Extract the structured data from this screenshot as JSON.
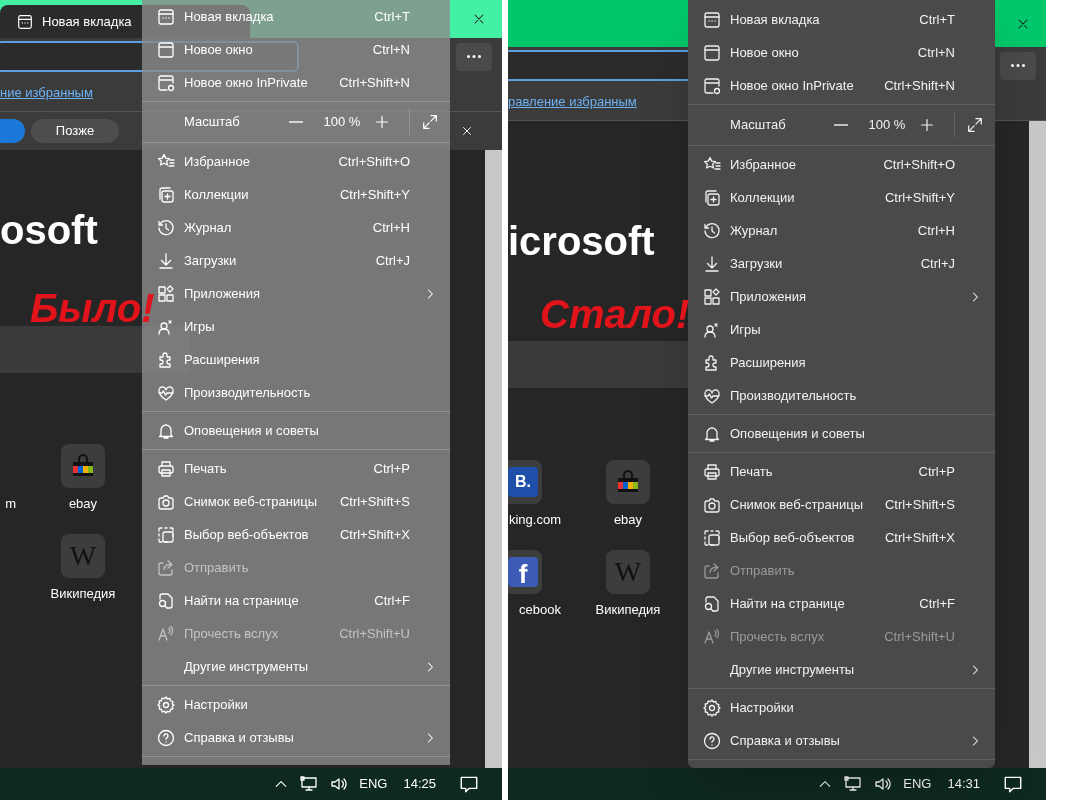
{
  "panels": [
    {
      "caption": "Было!",
      "translucent_menu": true,
      "tab": {
        "title": "Новая вкладка"
      },
      "favorites_link": "ние избранным",
      "notification": {
        "later_button": "Позже"
      },
      "brand": "osoft",
      "tile_rows": [
        [
          {
            "label": "m"
          },
          {
            "label": "ebay",
            "kind": "bag"
          }
        ],
        [
          {
            "label": "Википедия",
            "kind": "letter",
            "glyph": "W"
          }
        ]
      ],
      "menu": {
        "items": [
          {
            "kind": "item",
            "label": "Новая вкладка",
            "shortcut": "Ctrl+T",
            "disabled": false
          },
          {
            "kind": "item",
            "label": "Новое окно",
            "shortcut": "Ctrl+N",
            "disabled": false
          },
          {
            "kind": "item",
            "label": "Новое окно InPrivate",
            "shortcut": "Ctrl+Shift+N",
            "disabled": false
          },
          {
            "kind": "divider"
          },
          {
            "kind": "zoom",
            "label": "Масштаб",
            "value": "100 %"
          },
          {
            "kind": "divider"
          },
          {
            "kind": "item",
            "label": "Избранное",
            "shortcut": "Ctrl+Shift+O",
            "disabled": false
          },
          {
            "kind": "item",
            "label": "Коллекции",
            "shortcut": "Ctrl+Shift+Y",
            "disabled": false
          },
          {
            "kind": "item",
            "label": "Журнал",
            "shortcut": "Ctrl+H",
            "disabled": false
          },
          {
            "kind": "item",
            "label": "Загрузки",
            "shortcut": "Ctrl+J",
            "disabled": false
          },
          {
            "kind": "item",
            "label": "Приложения",
            "submenu": true,
            "disabled": false
          },
          {
            "kind": "item",
            "label": "Игры",
            "disabled": false
          },
          {
            "kind": "item",
            "label": "Расширения",
            "disabled": false
          },
          {
            "kind": "item",
            "label": "Производительность",
            "disabled": false
          },
          {
            "kind": "divider"
          },
          {
            "kind": "item",
            "label": "Оповещения и советы",
            "disabled": false
          },
          {
            "kind": "divider"
          },
          {
            "kind": "item",
            "label": "Печать",
            "shortcut": "Ctrl+P",
            "disabled": false
          },
          {
            "kind": "item",
            "label": "Снимок веб-страницы",
            "shortcut": "Ctrl+Shift+S",
            "disabled": false
          },
          {
            "kind": "item",
            "label": "Выбор веб-объектов",
            "shortcut": "Ctrl+Shift+X",
            "disabled": false
          },
          {
            "kind": "item",
            "label": "Отправить",
            "disabled": true
          },
          {
            "kind": "item",
            "label": "Найти на странице",
            "shortcut": "Ctrl+F",
            "disabled": false
          },
          {
            "kind": "item",
            "label": "Прочесть вслух",
            "shortcut": "Ctrl+Shift+U",
            "disabled": true
          },
          {
            "kind": "item",
            "label": "Другие инструменты",
            "submenu": true,
            "disabled": false
          },
          {
            "kind": "divider"
          },
          {
            "kind": "item",
            "label": "Настройки",
            "disabled": false
          },
          {
            "kind": "item",
            "label": "Справка и отзывы",
            "submenu": true,
            "disabled": false
          },
          {
            "kind": "divider"
          }
        ]
      },
      "taskbar": {
        "language": "ENG",
        "time": "14:25"
      }
    },
    {
      "caption": "Стало!",
      "translucent_menu": false,
      "favorites_link": "равление избранным",
      "brand": "icrosoft",
      "tile_rows": [
        [
          {
            "label": "king.com",
            "kind": "letter",
            "glyph": "B."
          },
          {
            "label": "ebay",
            "kind": "bag"
          }
        ],
        [
          {
            "label": "cebook",
            "kind": "letter",
            "glyph": "f"
          },
          {
            "label": "Википедия",
            "kind": "letter",
            "glyph": "W"
          }
        ]
      ],
      "menu": {
        "items": [
          {
            "kind": "item",
            "label": "Новая вкладка",
            "shortcut": "Ctrl+T",
            "disabled": false
          },
          {
            "kind": "item",
            "label": "Новое окно",
            "shortcut": "Ctrl+N",
            "disabled": false
          },
          {
            "kind": "item",
            "label": "Новое окно InPrivate",
            "shortcut": "Ctrl+Shift+N",
            "disabled": false
          },
          {
            "kind": "divider"
          },
          {
            "kind": "zoom",
            "label": "Масштаб",
            "value": "100 %"
          },
          {
            "kind": "divider"
          },
          {
            "kind": "item",
            "label": "Избранное",
            "shortcut": "Ctrl+Shift+O",
            "disabled": false
          },
          {
            "kind": "item",
            "label": "Коллекции",
            "shortcut": "Ctrl+Shift+Y",
            "disabled": false
          },
          {
            "kind": "item",
            "label": "Журнал",
            "shortcut": "Ctrl+H",
            "disabled": false
          },
          {
            "kind": "item",
            "label": "Загрузки",
            "shortcut": "Ctrl+J",
            "disabled": false
          },
          {
            "kind": "item",
            "label": "Приложения",
            "submenu": true,
            "disabled": false
          },
          {
            "kind": "item",
            "label": "Игры",
            "disabled": false
          },
          {
            "kind": "item",
            "label": "Расширения",
            "disabled": false
          },
          {
            "kind": "item",
            "label": "Производительность",
            "disabled": false
          },
          {
            "kind": "divider"
          },
          {
            "kind": "item",
            "label": "Оповещения и советы",
            "disabled": false
          },
          {
            "kind": "divider"
          },
          {
            "kind": "item",
            "label": "Печать",
            "shortcut": "Ctrl+P",
            "disabled": false
          },
          {
            "kind": "item",
            "label": "Снимок веб-страницы",
            "shortcut": "Ctrl+Shift+S",
            "disabled": false
          },
          {
            "kind": "item",
            "label": "Выбор веб-объектов",
            "shortcut": "Ctrl+Shift+X",
            "disabled": false
          },
          {
            "kind": "item",
            "label": "Отправить",
            "disabled": true
          },
          {
            "kind": "item",
            "label": "Найти на странице",
            "shortcut": "Ctrl+F",
            "disabled": false
          },
          {
            "kind": "item",
            "label": "Прочесть вслух",
            "shortcut": "Ctrl+Shift+U",
            "disabled": true
          },
          {
            "kind": "item",
            "label": "Другие инструменты",
            "submenu": true,
            "disabled": false
          },
          {
            "kind": "divider"
          },
          {
            "kind": "item",
            "label": "Настройки",
            "disabled": false
          },
          {
            "kind": "item",
            "label": "Справка и отзывы",
            "submenu": true,
            "disabled": false
          },
          {
            "kind": "divider"
          }
        ]
      },
      "taskbar": {
        "language": "ENG",
        "time": "14:31"
      }
    }
  ]
}
